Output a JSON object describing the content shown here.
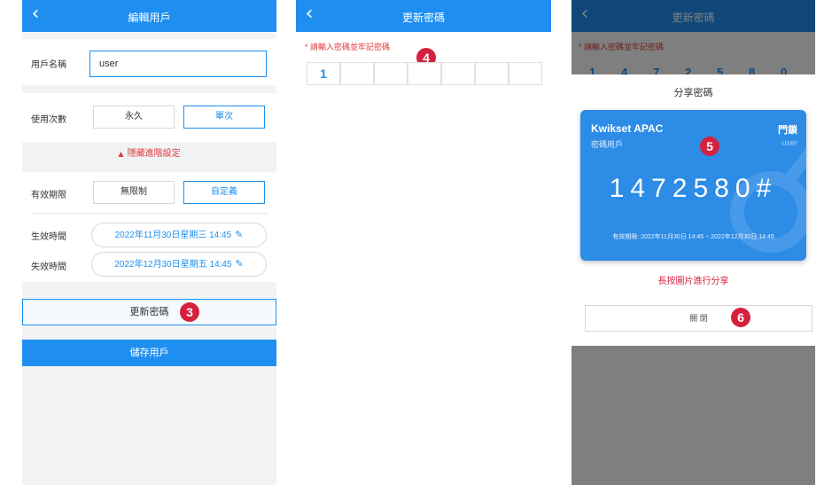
{
  "colors": {
    "primary": "#1e8ff0",
    "badge": "#d4213d",
    "required": "#e03a3a",
    "card_blue": "#2d8ce6"
  },
  "screen1": {
    "header": {
      "title": "編輯用戶",
      "back_icon": "chevron-left"
    },
    "username": {
      "label": "用戶名稱",
      "value": "user"
    },
    "usage": {
      "label": "使用次數",
      "options": [
        "永久",
        "單次"
      ],
      "selected": "單次"
    },
    "advanced_toggle": {
      "icon": "triangle-up",
      "label": "隱藏進階設定"
    },
    "validity": {
      "label": "有效期限",
      "options": [
        "無限制",
        "自定義"
      ],
      "selected": "自定義"
    },
    "start_time": {
      "label": "生效時間",
      "value": "2022年11月30日星期三 14:45"
    },
    "end_time": {
      "label": "失效時間",
      "value": "2022年12月30日星期五 14:45"
    },
    "update_button": "更新密碼",
    "save_button": "儲存用戶",
    "badge": "3"
  },
  "screen2": {
    "header": {
      "title": "更新密碼",
      "back_icon": "chevron-left"
    },
    "instruction": "* 請輸入密碼並牢記密碼",
    "pin_digits": [
      "1",
      "",
      "",
      "",
      "",
      "",
      ""
    ],
    "badge": "4"
  },
  "screen3": {
    "header": {
      "title": "更新密碼"
    },
    "instruction": "* 請輸入密碼並牢記密碼",
    "bg_digits": [
      "1",
      "4",
      "7",
      "2",
      "5",
      "8",
      "0"
    ],
    "share": {
      "title": "分享密碼",
      "card_brand": "Kwikset APAC",
      "card_device": "門鎖",
      "card_user_label": "密碼用戶",
      "card_user": "user",
      "code": "1472580#",
      "validity": "有效期限: 2022年11月30日 14:45 ~ 2022年12月30日 14:45",
      "hint": "長按圖片進行分享",
      "close": "關 閉"
    },
    "badge_card": "5",
    "badge_close": "6"
  }
}
